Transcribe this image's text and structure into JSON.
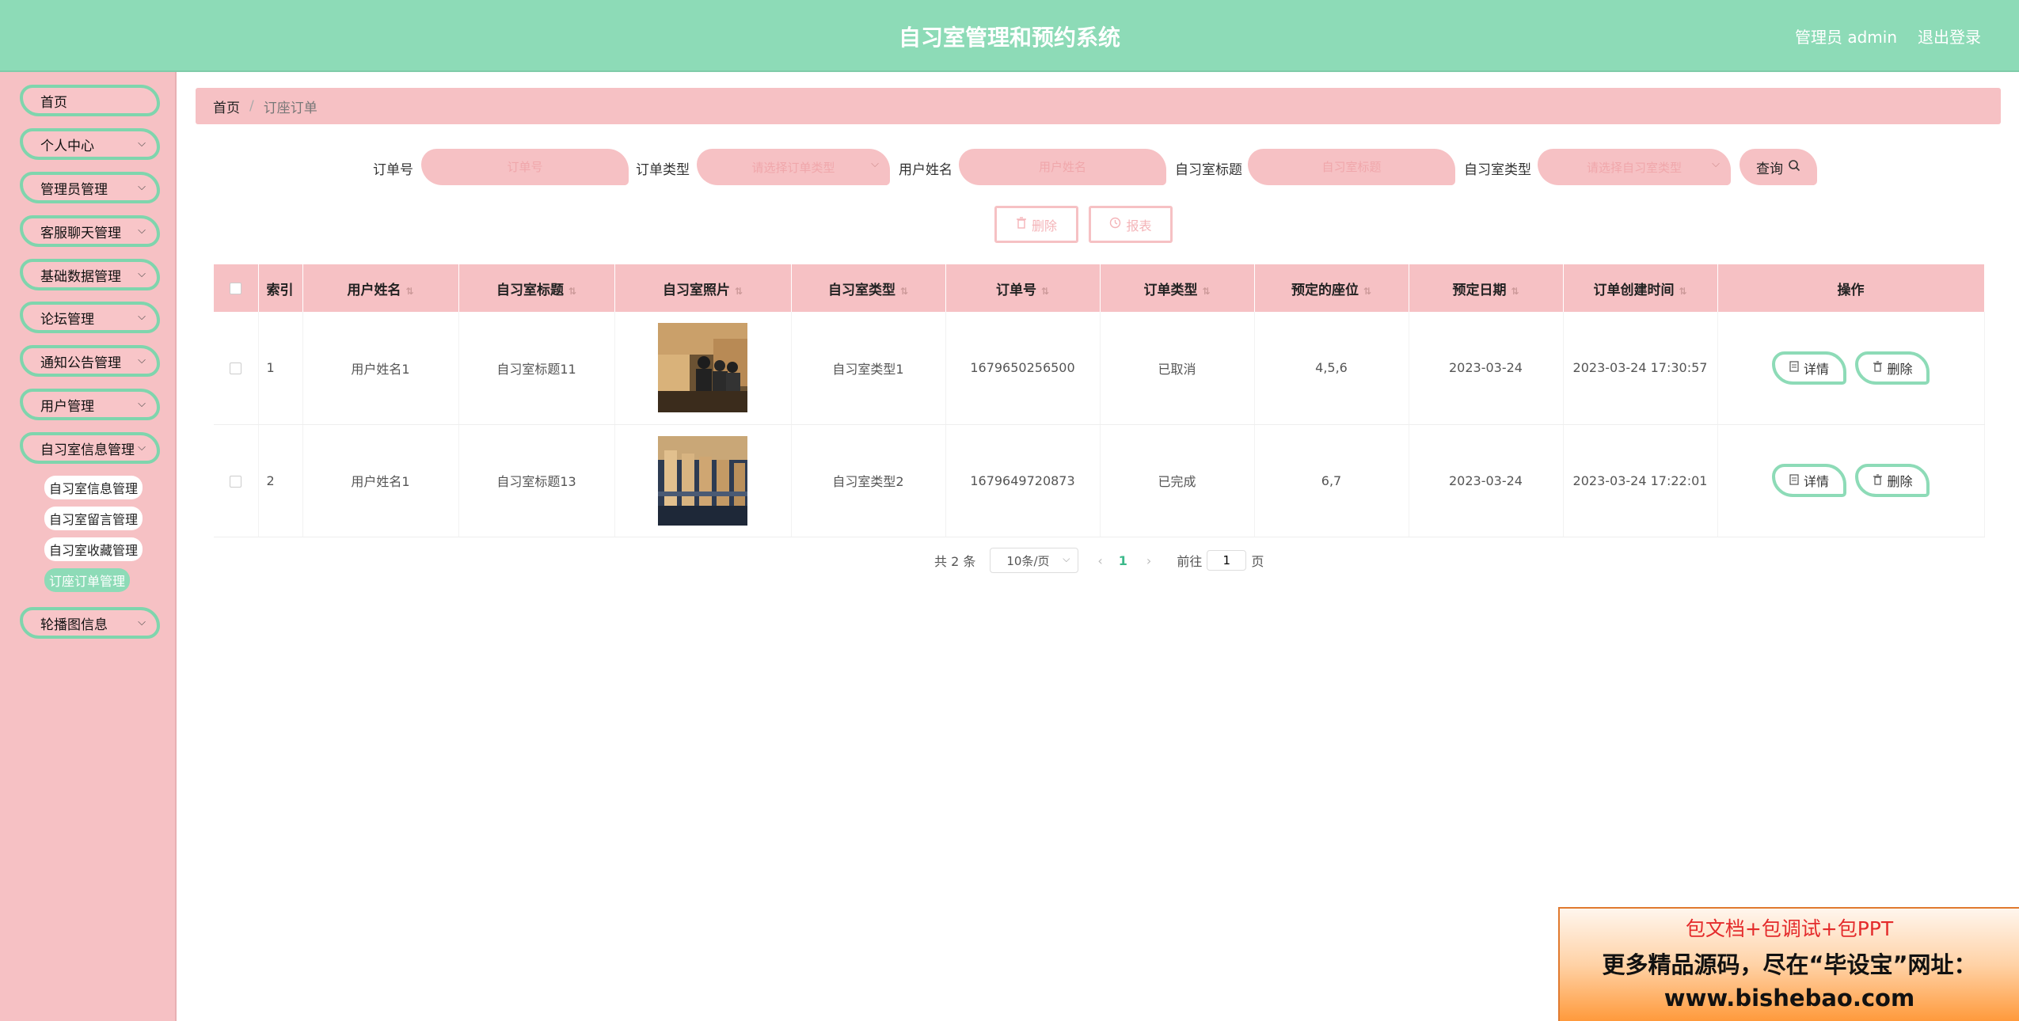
{
  "header": {
    "title": "自习室管理和预约系统",
    "user": "管理员 admin",
    "logout": "退出登录"
  },
  "sidebar": {
    "items": [
      {
        "label": "首页",
        "chev": false
      },
      {
        "label": "个人中心",
        "chev": true
      },
      {
        "label": "管理员管理",
        "chev": true
      },
      {
        "label": "客服聊天管理",
        "chev": true
      },
      {
        "label": "基础数据管理",
        "chev": true
      },
      {
        "label": "论坛管理",
        "chev": true
      },
      {
        "label": "通知公告管理",
        "chev": true
      },
      {
        "label": "用户管理",
        "chev": true
      },
      {
        "label": "自习室信息管理",
        "chev": true
      },
      {
        "label": "轮播图信息",
        "chev": true
      }
    ],
    "subitems": [
      "自习室信息管理",
      "自习室留言管理",
      "自习室收藏管理",
      "订座订单管理"
    ]
  },
  "breadcrumb": {
    "home": "首页",
    "current": "订座订单"
  },
  "search": {
    "order_no_label": "订单号",
    "order_no_placeholder": "订单号",
    "order_type_label": "订单类型",
    "order_type_placeholder": "请选择订单类型",
    "user_name_label": "用户姓名",
    "user_name_placeholder": "用户姓名",
    "room_title_label": "自习室标题",
    "room_title_placeholder": "自习室标题",
    "room_type_label": "自习室类型",
    "room_type_placeholder": "请选择自习室类型",
    "query_label": "查询"
  },
  "actions": {
    "delete": "删除",
    "report": "报表"
  },
  "table": {
    "columns": [
      "索引",
      "用户姓名",
      "自习室标题",
      "自习室照片",
      "自习室类型",
      "订单号",
      "订单类型",
      "预定的座位",
      "预定日期",
      "订单创建时间",
      "操作"
    ],
    "rows": [
      {
        "index": "1",
        "user": "用户姓名1",
        "title": "自习室标题11",
        "type": "自习室类型1",
        "order_no": "1679650256500",
        "order_type": "已取消",
        "seats": "4,5,6",
        "date": "2023-03-24",
        "created": "2023-03-24 17:30:57"
      },
      {
        "index": "2",
        "user": "用户姓名1",
        "title": "自习室标题13",
        "type": "自习室类型2",
        "order_no": "1679649720873",
        "order_type": "已完成",
        "seats": "6,7",
        "date": "2023-03-24",
        "created": "2023-03-24 17:22:01"
      }
    ],
    "detail_label": "详情",
    "delete_label": "删除"
  },
  "pagination": {
    "total": "共 2 条",
    "page_size": "10条/页",
    "current": "1",
    "goto_label": "前往",
    "goto_value": "1",
    "page_suffix": "页"
  },
  "ad": {
    "line1": "包文档+包调试+包PPT",
    "line2": "更多精品源码，尽在“毕设宝”网址：",
    "line3": "www.bishebao.com"
  },
  "colors": {
    "header": "#8ddbb7",
    "sidebar": "#f6c1c4",
    "accent_border": "#7fd5ad",
    "pink": "#f6c1c4"
  }
}
